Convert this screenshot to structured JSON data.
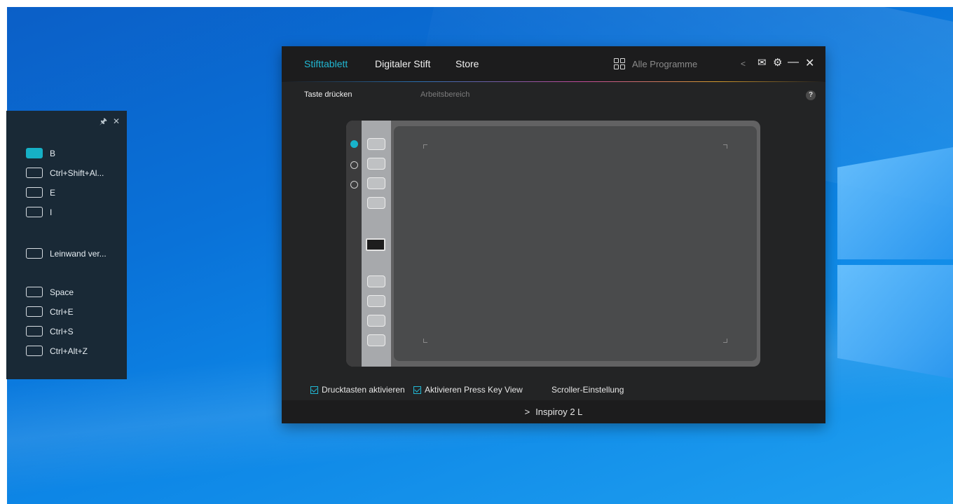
{
  "panel": {
    "pin_icon": "pin-icon",
    "close_icon": "close-icon",
    "items": [
      {
        "label": "B",
        "active": true
      },
      {
        "label": "Ctrl+Shift+Al...",
        "active": false
      },
      {
        "label": "E",
        "active": false
      },
      {
        "label": "I",
        "active": false
      },
      {
        "label": "Leinwand ver...",
        "active": false
      },
      {
        "label": "Space",
        "active": false
      },
      {
        "label": "Ctrl+E",
        "active": false
      },
      {
        "label": "Ctrl+S",
        "active": false
      },
      {
        "label": "Ctrl+Alt+Z",
        "active": false
      }
    ]
  },
  "window": {
    "tabs": [
      {
        "label": "Stifttablett",
        "active": true
      },
      {
        "label": "Digitaler Stift",
        "active": false
      },
      {
        "label": "Store",
        "active": false
      }
    ],
    "program_selector": {
      "label": "Alle Programme",
      "icon": "grid-icon",
      "chevron": "<"
    },
    "controls": {
      "mail": "✉",
      "settings": "⚙",
      "minimize": "—",
      "close": "✕"
    },
    "subtabs": [
      {
        "label": "Taste drücken",
        "active": true
      },
      {
        "label": "Arbeitsbereich",
        "active": false
      }
    ],
    "help": "?",
    "checkboxes": [
      {
        "label": "Drucktasten aktivieren",
        "checked": true
      },
      {
        "label": "Aktivieren Press Key View",
        "checked": true
      }
    ],
    "scroller_label": "Scroller-Einstellung",
    "device": "Inspiroy 2 L",
    "device_arrow": ">"
  },
  "colors": {
    "accent": "#21b8d4",
    "panel_bg": "#192936",
    "window_bg": "#232425"
  }
}
